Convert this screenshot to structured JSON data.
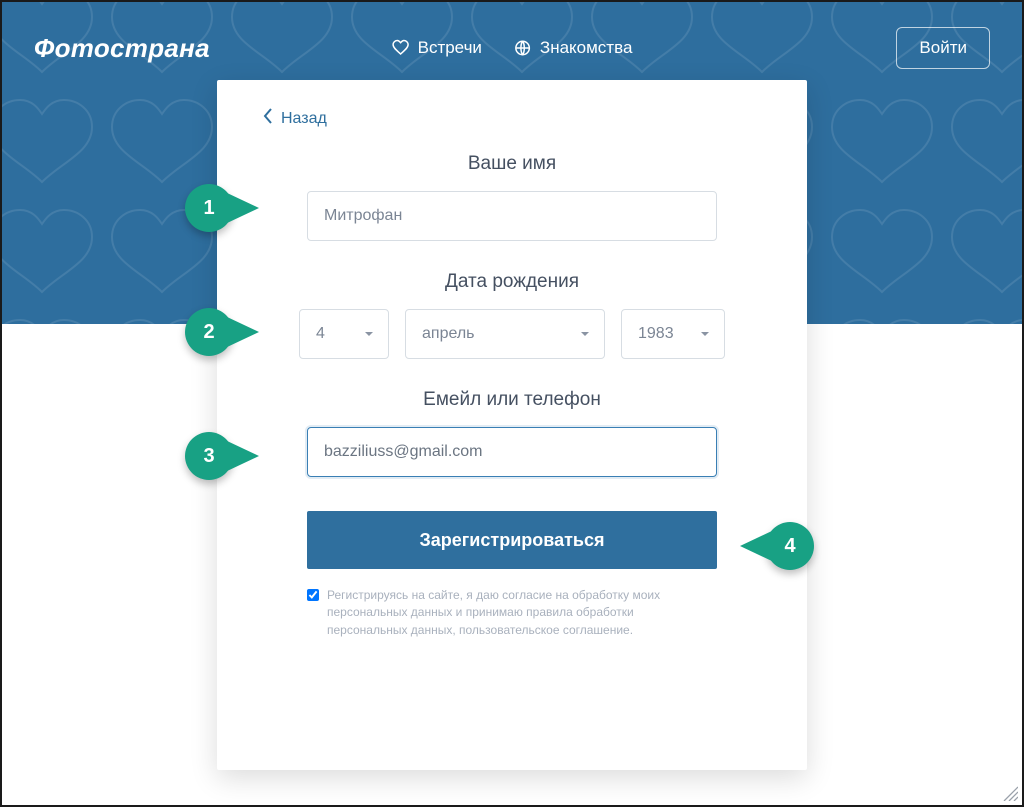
{
  "brand": {
    "logo": "Фотострана"
  },
  "nav": {
    "meet": "Встречи",
    "dating": "Знакомства",
    "login": "Войти"
  },
  "card": {
    "back": "Назад",
    "name_label": "Ваше имя",
    "name_value": "Митрофан",
    "dob_label": "Дата рождения",
    "day": "4",
    "month": "апрель",
    "year": "1983",
    "contact_label": "Емейл или телефон",
    "contact_value": "bazziliuss@gmail.com",
    "submit": "Зарегистрироваться",
    "consent": "Регистрируясь на сайте, я даю согласие на обработку моих персональных данных и принимаю правила обработки персональных данных, пользовательское соглашение."
  },
  "annotations": {
    "color": "#18a184",
    "m1": "1",
    "m2": "2",
    "m3": "3",
    "m4": "4"
  }
}
